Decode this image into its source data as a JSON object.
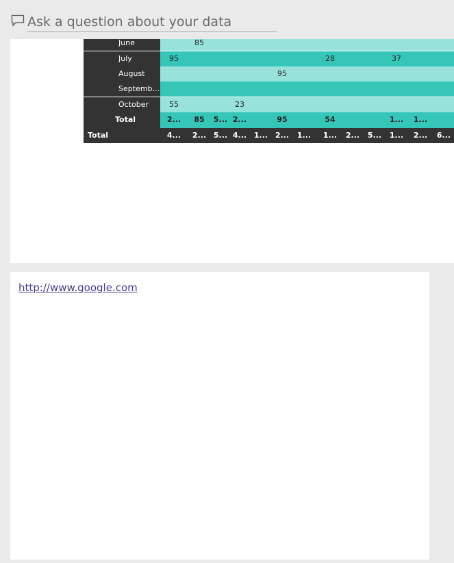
{
  "qa": {
    "placeholder": "Ask a question about your data",
    "icon": "speech-bubble-icon"
  },
  "matrix": {
    "rows": [
      {
        "label": "June",
        "style": "light",
        "cells": [
          "",
          "85",
          "",
          "",
          "",
          "",
          "",
          "",
          "",
          "",
          "",
          "",
          ""
        ]
      },
      {
        "label": "July",
        "style": "dark",
        "cells": [
          "95",
          "",
          "",
          "",
          "",
          "",
          "",
          "28",
          "",
          "",
          "37",
          "",
          ""
        ]
      },
      {
        "label": "August",
        "style": "light",
        "cells": [
          "",
          "",
          "",
          "",
          "",
          "95",
          "",
          "",
          "",
          "",
          "",
          "",
          ""
        ]
      },
      {
        "label": "Septemb...",
        "style": "dark",
        "cells": [
          "",
          "",
          "",
          "",
          "",
          "",
          "",
          "",
          "",
          "",
          "",
          "",
          ""
        ]
      },
      {
        "label": "October",
        "style": "light",
        "cells": [
          "55",
          "",
          "",
          "23",
          "",
          "",
          "",
          "",
          "",
          "",
          "",
          "",
          ""
        ]
      },
      {
        "label": "Total",
        "style": "total",
        "cells": [
          "2...",
          "85",
          "5...",
          "2...",
          "",
          "95",
          "",
          "54",
          "",
          "",
          "1...",
          "1...",
          ""
        ]
      },
      {
        "label": "Total",
        "style": "grand",
        "cells": [
          "4...",
          "2...",
          "5...",
          "4...",
          "1...",
          "2...",
          "1...",
          "1...",
          "2...",
          "5...",
          "1...",
          "2...",
          "6..."
        ]
      }
    ]
  },
  "link": {
    "text": "http://www.google.com"
  }
}
